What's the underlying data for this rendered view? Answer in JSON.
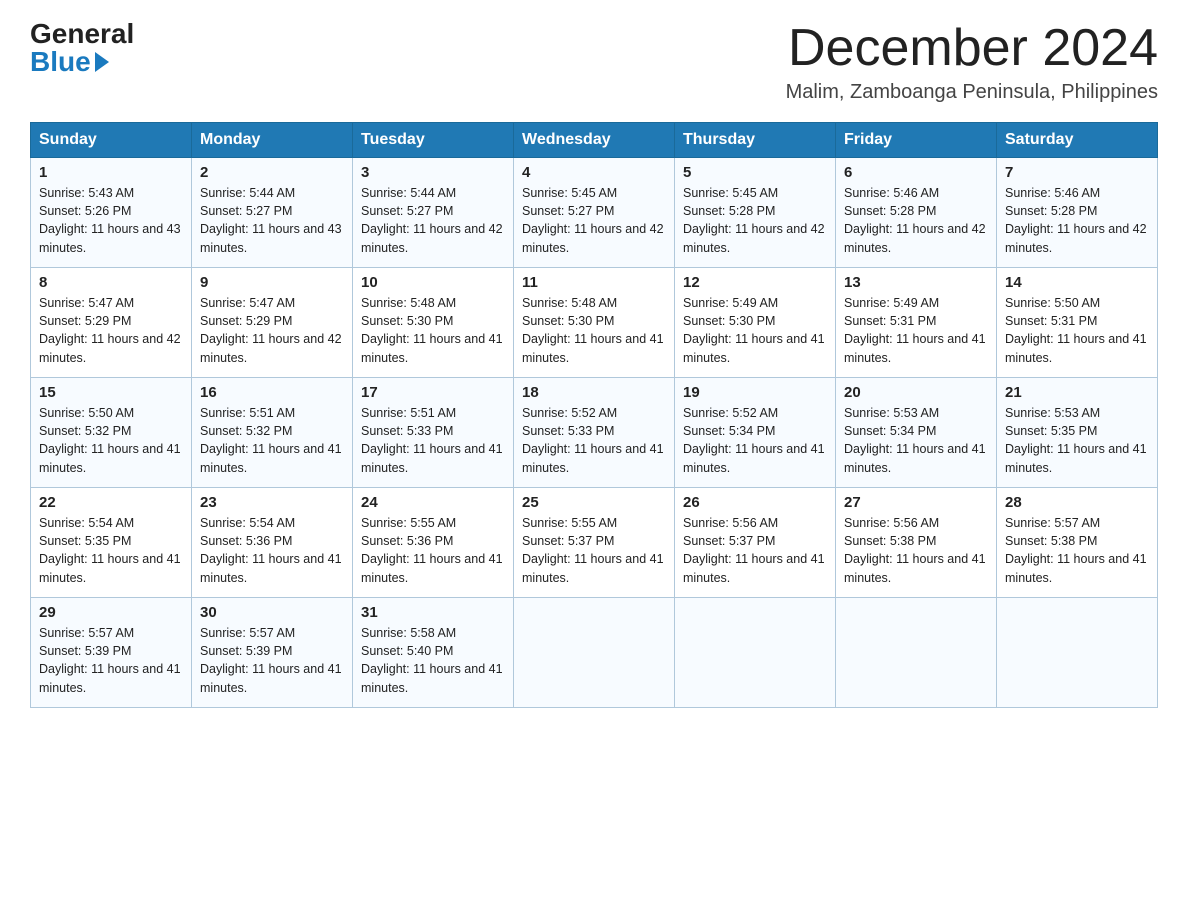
{
  "header": {
    "logo_general": "General",
    "logo_blue": "Blue",
    "month_title": "December 2024",
    "location": "Malim, Zamboanga Peninsula, Philippines"
  },
  "days_of_week": [
    "Sunday",
    "Monday",
    "Tuesday",
    "Wednesday",
    "Thursday",
    "Friday",
    "Saturday"
  ],
  "weeks": [
    [
      {
        "day": 1,
        "sunrise": "5:43 AM",
        "sunset": "5:26 PM",
        "daylight": "11 hours and 43 minutes."
      },
      {
        "day": 2,
        "sunrise": "5:44 AM",
        "sunset": "5:27 PM",
        "daylight": "11 hours and 43 minutes."
      },
      {
        "day": 3,
        "sunrise": "5:44 AM",
        "sunset": "5:27 PM",
        "daylight": "11 hours and 42 minutes."
      },
      {
        "day": 4,
        "sunrise": "5:45 AM",
        "sunset": "5:27 PM",
        "daylight": "11 hours and 42 minutes."
      },
      {
        "day": 5,
        "sunrise": "5:45 AM",
        "sunset": "5:28 PM",
        "daylight": "11 hours and 42 minutes."
      },
      {
        "day": 6,
        "sunrise": "5:46 AM",
        "sunset": "5:28 PM",
        "daylight": "11 hours and 42 minutes."
      },
      {
        "day": 7,
        "sunrise": "5:46 AM",
        "sunset": "5:28 PM",
        "daylight": "11 hours and 42 minutes."
      }
    ],
    [
      {
        "day": 8,
        "sunrise": "5:47 AM",
        "sunset": "5:29 PM",
        "daylight": "11 hours and 42 minutes."
      },
      {
        "day": 9,
        "sunrise": "5:47 AM",
        "sunset": "5:29 PM",
        "daylight": "11 hours and 42 minutes."
      },
      {
        "day": 10,
        "sunrise": "5:48 AM",
        "sunset": "5:30 PM",
        "daylight": "11 hours and 41 minutes."
      },
      {
        "day": 11,
        "sunrise": "5:48 AM",
        "sunset": "5:30 PM",
        "daylight": "11 hours and 41 minutes."
      },
      {
        "day": 12,
        "sunrise": "5:49 AM",
        "sunset": "5:30 PM",
        "daylight": "11 hours and 41 minutes."
      },
      {
        "day": 13,
        "sunrise": "5:49 AM",
        "sunset": "5:31 PM",
        "daylight": "11 hours and 41 minutes."
      },
      {
        "day": 14,
        "sunrise": "5:50 AM",
        "sunset": "5:31 PM",
        "daylight": "11 hours and 41 minutes."
      }
    ],
    [
      {
        "day": 15,
        "sunrise": "5:50 AM",
        "sunset": "5:32 PM",
        "daylight": "11 hours and 41 minutes."
      },
      {
        "day": 16,
        "sunrise": "5:51 AM",
        "sunset": "5:32 PM",
        "daylight": "11 hours and 41 minutes."
      },
      {
        "day": 17,
        "sunrise": "5:51 AM",
        "sunset": "5:33 PM",
        "daylight": "11 hours and 41 minutes."
      },
      {
        "day": 18,
        "sunrise": "5:52 AM",
        "sunset": "5:33 PM",
        "daylight": "11 hours and 41 minutes."
      },
      {
        "day": 19,
        "sunrise": "5:52 AM",
        "sunset": "5:34 PM",
        "daylight": "11 hours and 41 minutes."
      },
      {
        "day": 20,
        "sunrise": "5:53 AM",
        "sunset": "5:34 PM",
        "daylight": "11 hours and 41 minutes."
      },
      {
        "day": 21,
        "sunrise": "5:53 AM",
        "sunset": "5:35 PM",
        "daylight": "11 hours and 41 minutes."
      }
    ],
    [
      {
        "day": 22,
        "sunrise": "5:54 AM",
        "sunset": "5:35 PM",
        "daylight": "11 hours and 41 minutes."
      },
      {
        "day": 23,
        "sunrise": "5:54 AM",
        "sunset": "5:36 PM",
        "daylight": "11 hours and 41 minutes."
      },
      {
        "day": 24,
        "sunrise": "5:55 AM",
        "sunset": "5:36 PM",
        "daylight": "11 hours and 41 minutes."
      },
      {
        "day": 25,
        "sunrise": "5:55 AM",
        "sunset": "5:37 PM",
        "daylight": "11 hours and 41 minutes."
      },
      {
        "day": 26,
        "sunrise": "5:56 AM",
        "sunset": "5:37 PM",
        "daylight": "11 hours and 41 minutes."
      },
      {
        "day": 27,
        "sunrise": "5:56 AM",
        "sunset": "5:38 PM",
        "daylight": "11 hours and 41 minutes."
      },
      {
        "day": 28,
        "sunrise": "5:57 AM",
        "sunset": "5:38 PM",
        "daylight": "11 hours and 41 minutes."
      }
    ],
    [
      {
        "day": 29,
        "sunrise": "5:57 AM",
        "sunset": "5:39 PM",
        "daylight": "11 hours and 41 minutes."
      },
      {
        "day": 30,
        "sunrise": "5:57 AM",
        "sunset": "5:39 PM",
        "daylight": "11 hours and 41 minutes."
      },
      {
        "day": 31,
        "sunrise": "5:58 AM",
        "sunset": "5:40 PM",
        "daylight": "11 hours and 41 minutes."
      },
      null,
      null,
      null,
      null
    ]
  ]
}
